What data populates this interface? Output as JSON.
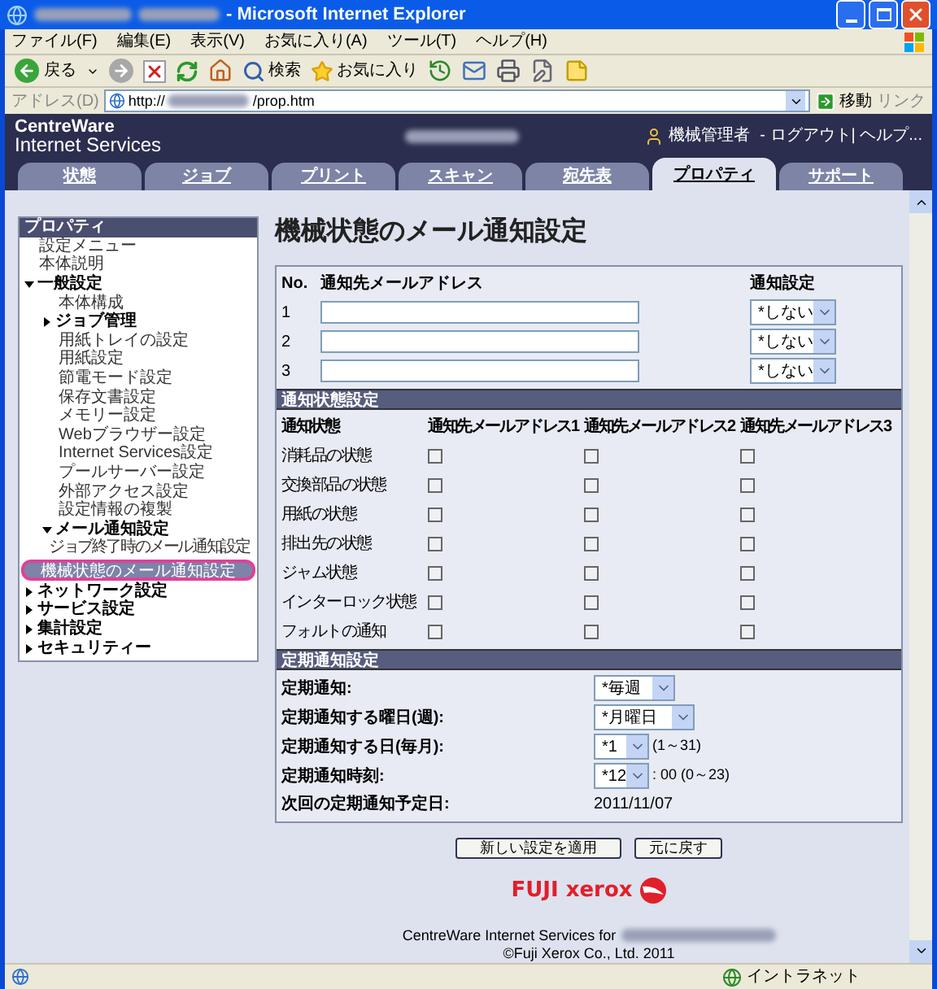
{
  "window": {
    "title": "- Microsoft Internet Explorer"
  },
  "menu": [
    "ファイル(F)",
    "編集(E)",
    "表示(V)",
    "お気に入り(A)",
    "ツール(T)",
    "ヘルプ(H)"
  ],
  "toolbar": {
    "back": "戻る",
    "search": "検索",
    "favorites": "お気に入り"
  },
  "address": {
    "label": "アドレス(D)",
    "url_prefix": "http://",
    "url_suffix": "/prop.htm",
    "go": "移動",
    "links": "リンク"
  },
  "header": {
    "brand": [
      "CentreWare",
      "Internet Services"
    ],
    "user": "機械管理者",
    "links": "- ログアウト| ヘルプ..."
  },
  "tabs": [
    {
      "label": "状態",
      "selected": false
    },
    {
      "label": "ジョブ",
      "selected": false
    },
    {
      "label": "プリント",
      "selected": false
    },
    {
      "label": "スキャン",
      "selected": false
    },
    {
      "label": "宛先表",
      "selected": false
    },
    {
      "label": "プロパティ",
      "selected": true
    },
    {
      "label": "サポート",
      "selected": false
    }
  ],
  "sidebar": {
    "title": "プロパティ",
    "items": [
      {
        "kind": "page",
        "label": "設定メニュー",
        "selected": false
      },
      {
        "kind": "page",
        "label": "本体説明",
        "selected": false
      },
      {
        "kind": "folder",
        "label": "一般設定",
        "expanded": true,
        "selected": false,
        "children": [
          {
            "kind": "page",
            "label": "本体構成",
            "selected": false
          },
          {
            "kind": "folder",
            "label": "ジョブ管理",
            "expanded": false,
            "selected": false
          },
          {
            "kind": "page",
            "label": "用紙トレイの設定",
            "selected": false
          },
          {
            "kind": "page",
            "label": "用紙設定",
            "selected": false
          },
          {
            "kind": "page",
            "label": "節電モード設定",
            "selected": false
          },
          {
            "kind": "page",
            "label": "保存文書設定",
            "selected": false
          },
          {
            "kind": "page",
            "label": "メモリー設定",
            "selected": false
          },
          {
            "kind": "page",
            "label": "Webブラウザー設定",
            "selected": false
          },
          {
            "kind": "page",
            "label": "Internet Services設定",
            "selected": false
          },
          {
            "kind": "page",
            "label": "プールサーバー設定",
            "selected": false
          },
          {
            "kind": "page",
            "label": "外部アクセス設定",
            "selected": false
          },
          {
            "kind": "page",
            "label": "設定情報の複製",
            "selected": false
          },
          {
            "kind": "folder",
            "label": "メール通知設定",
            "expanded": true,
            "selected": false,
            "children": [
              {
                "kind": "page",
                "label": "ジョブ終了時のメール通知設定",
                "selected": false
              },
              {
                "kind": "page",
                "label": "機械状態のメール通知設定",
                "selected": true
              }
            ]
          }
        ]
      },
      {
        "kind": "folder",
        "label": "ネットワーク設定",
        "expanded": false,
        "selected": false
      },
      {
        "kind": "folder",
        "label": "サービス設定",
        "expanded": false,
        "selected": false
      },
      {
        "kind": "folder",
        "label": "集計設定",
        "expanded": false,
        "selected": false
      },
      {
        "kind": "folder",
        "label": "セキュリティー",
        "expanded": false,
        "selected": false
      }
    ]
  },
  "page_title": "機械状態のメール通知設定",
  "addresses": {
    "columns": [
      "No.",
      "通知先メールアドレス",
      "通知設定"
    ],
    "rows": [
      {
        "no": "1",
        "setting": "*しない"
      },
      {
        "no": "2",
        "setting": "*しない"
      },
      {
        "no": "3",
        "setting": "*しない"
      }
    ]
  },
  "status_section": {
    "title": "通知状態設定",
    "columns": [
      "通知状態",
      "通知先メールアドレス1",
      "通知先メールアドレス2",
      "通知先メールアドレス3"
    ],
    "rows": [
      {
        "label": "消耗品の状態",
        "checked": [
          false,
          false,
          false
        ]
      },
      {
        "label": "交換部品の状態",
        "checked": [
          false,
          false,
          false
        ]
      },
      {
        "label": "用紙の状態",
        "checked": [
          false,
          false,
          false
        ]
      },
      {
        "label": "排出先の状態",
        "checked": [
          false,
          false,
          false
        ]
      },
      {
        "label": "ジャム状態",
        "checked": [
          false,
          false,
          false
        ]
      },
      {
        "label": "インターロック状態",
        "checked": [
          false,
          false,
          false
        ]
      },
      {
        "label": "フォルトの通知",
        "checked": [
          false,
          false,
          false
        ]
      }
    ]
  },
  "periodic_section": {
    "title": "定期通知設定",
    "rows": [
      {
        "kind": "select",
        "label": "定期通知:",
        "value": "*毎週"
      },
      {
        "kind": "select",
        "label": "定期通知する曜日(週):",
        "value": "*月曜日"
      },
      {
        "kind": "select",
        "label": "定期通知する日(毎月):",
        "value": "*1",
        "suffix": "(1～31)"
      },
      {
        "kind": "select",
        "label": "定期通知時刻:",
        "value": "*12",
        "suffix": ": 00 (0～23)"
      },
      {
        "kind": "text",
        "label": "次回の定期通知予定日:",
        "value": "2011/11/07"
      }
    ]
  },
  "buttons": [
    "新しい設定を適用",
    "元に戻す"
  ],
  "logo": "FUJI xerox",
  "footer": {
    "product": "CentreWare Internet Services for",
    "copyright": "©Fuji Xerox Co., Ltd. 2011"
  },
  "status_bar": {
    "zone": "イントラネット"
  }
}
